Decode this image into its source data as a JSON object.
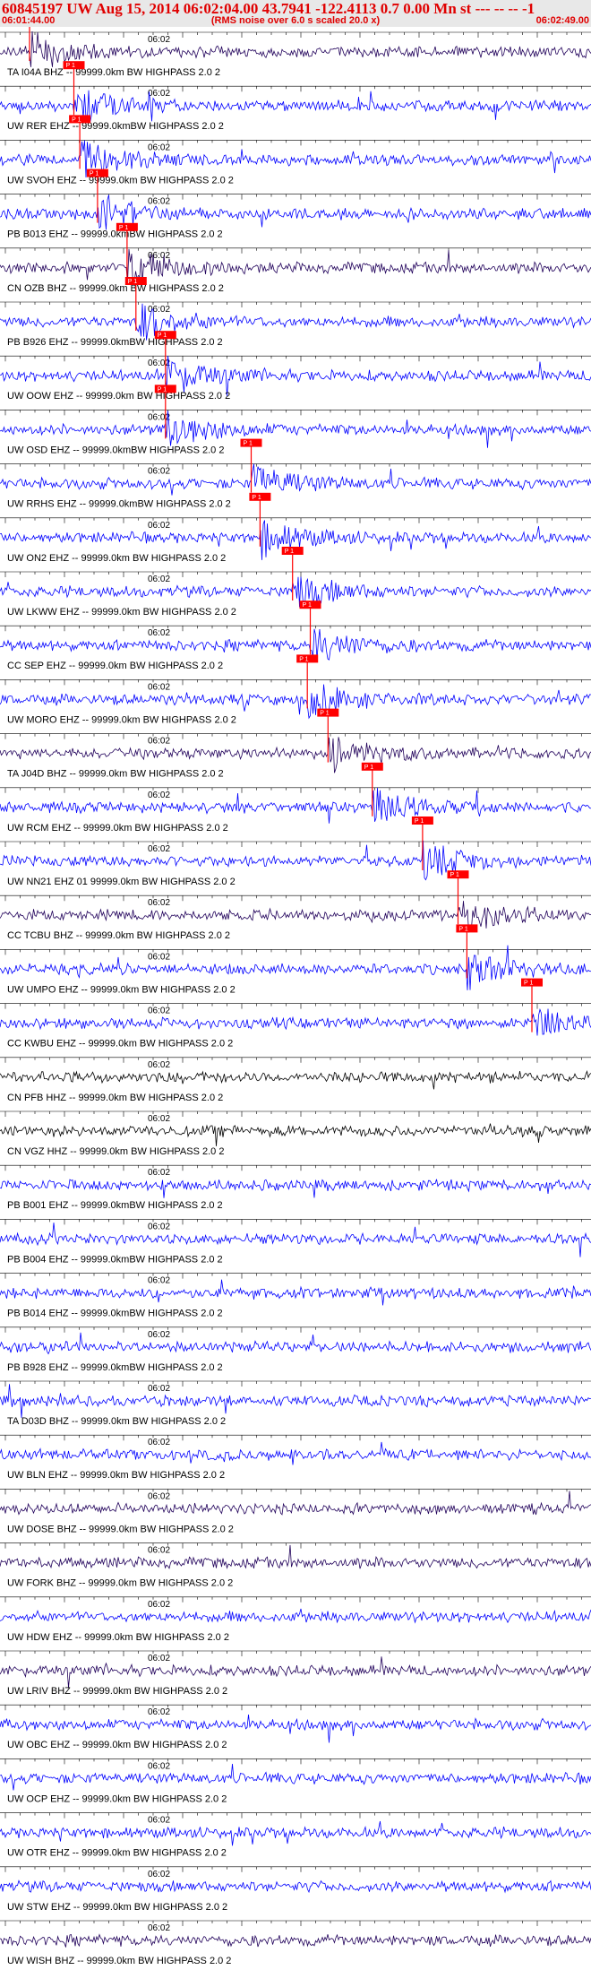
{
  "header": {
    "title": "60845197 UW Aug 15, 2014 06:02:04.00   43.7941 -122.4113  0.7 0.00 Mn st --- -- --  -1",
    "start_time": "06:01:44.00",
    "note": "(RMS noise over 6.0 s scaled 20.0 x)",
    "end_time": "06:02:49.00"
  },
  "tick_label": "06:02",
  "pick_label": "P 1",
  "colors": {
    "trace": "#0000ff",
    "trace_dark": "#20005a",
    "trace_black": "#000000",
    "pick": "#ff0000",
    "text": "#e00000"
  },
  "traces": [
    {
      "label": "TA I04A BHZ -- 99999.0km BW  HIGHPASS  2.0  2",
      "color": "dark",
      "pick": 0.05
    },
    {
      "label": "UW RER EHZ -- 99999.0kmBW  HIGHPASS  2.0  2",
      "color": "blue",
      "pick": 0.125
    },
    {
      "label": "UW SVOH EHZ -- 99999.0km BW  HIGHPASS  2.0  2",
      "color": "blue",
      "pick": 0.135
    },
    {
      "label": "PB B013 EHZ -- 99999.0kmBW  HIGHPASS  2.0  2",
      "color": "blue",
      "pick": 0.165
    },
    {
      "label": "CN OZB BHZ -- 99999.0km BW  HIGHPASS  2.0  2",
      "color": "dark",
      "pick": 0.215
    },
    {
      "label": "PB B926 EHZ -- 99999.0kmBW  HIGHPASS  2.0  2",
      "color": "blue",
      "pick": 0.23
    },
    {
      "label": "UW OOW EHZ -- 99999.0km BW  HIGHPASS  2.0  2",
      "color": "blue",
      "pick": 0.28
    },
    {
      "label": "UW OSD EHZ -- 99999.0kmBW  HIGHPASS  2.0  2",
      "color": "blue",
      "pick": 0.28
    },
    {
      "label": "UW RRHS EHZ -- 99999.0kmBW  HIGHPASS  2.0  2",
      "color": "blue",
      "pick": 0.425
    },
    {
      "label": "UW ON2 EHZ -- 99999.0km BW  HIGHPASS  2.0  2",
      "color": "blue",
      "pick": 0.44
    },
    {
      "label": "UW LKWW EHZ -- 99999.0km BW  HIGHPASS  2.0  2",
      "color": "blue",
      "pick": 0.495
    },
    {
      "label": "CC SEP EHZ -- 99999.0km BW  HIGHPASS  2.0  2",
      "color": "blue",
      "pick": 0.525
    },
    {
      "label": "UW MORO EHZ -- 99999.0km BW  HIGHPASS  2.0  2",
      "color": "blue",
      "pick": 0.52
    },
    {
      "label": "TA J04D BHZ -- 99999.0km BW  HIGHPASS  2.0  2",
      "color": "dark",
      "pick": 0.555
    },
    {
      "label": "UW RCM EHZ -- 99999.0km BW  HIGHPASS  2.0  2",
      "color": "blue",
      "pick": 0.63
    },
    {
      "label": "UW NN21 EHZ 01 99999.0km BW  HIGHPASS  2.0  2",
      "color": "blue",
      "pick": 0.715
    },
    {
      "label": "CC TCBU BHZ -- 99999.0km BW  HIGHPASS  2.0  2",
      "color": "dark",
      "pick": 0.775
    },
    {
      "label": "UW UMPO EHZ -- 99999.0km BW  HIGHPASS  2.0  2",
      "color": "blue",
      "pick": 0.79
    },
    {
      "label": "CC KWBU EHZ -- 99999.0km BW  HIGHPASS  2.0  2",
      "color": "blue",
      "pick": 0.9
    },
    {
      "label": "CN PFB HHZ -- 99999.0km BW  HIGHPASS  2.0  2",
      "color": "black",
      "pick": null
    },
    {
      "label": "CN VGZ HHZ -- 99999.0km BW  HIGHPASS  2.0  2",
      "color": "black",
      "pick": null
    },
    {
      "label": "PB B001 EHZ -- 99999.0kmBW  HIGHPASS  2.0  2",
      "color": "blue",
      "pick": null
    },
    {
      "label": "PB B004 EHZ -- 99999.0kmBW  HIGHPASS  2.0  2",
      "color": "blue",
      "pick": null
    },
    {
      "label": "PB B014 EHZ -- 99999.0kmBW  HIGHPASS  2.0  2",
      "color": "blue",
      "pick": null
    },
    {
      "label": "PB B928 EHZ -- 99999.0kmBW  HIGHPASS  2.0  2",
      "color": "blue",
      "pick": null
    },
    {
      "label": "TA D03D BHZ -- 99999.0km BW  HIGHPASS  2.0  2",
      "color": "blue",
      "pick": null
    },
    {
      "label": "UW BLN EHZ -- 99999.0km BW  HIGHPASS  2.0  2",
      "color": "blue",
      "pick": null
    },
    {
      "label": "UW DOSE BHZ -- 99999.0km BW  HIGHPASS  2.0  2",
      "color": "dark",
      "pick": null
    },
    {
      "label": "UW FORK BHZ -- 99999.0km BW  HIGHPASS  2.0  2",
      "color": "dark",
      "pick": null
    },
    {
      "label": "UW HDW EHZ -- 99999.0km BW  HIGHPASS  2.0  2",
      "color": "blue",
      "pick": null
    },
    {
      "label": "UW LRIV BHZ -- 99999.0km BW  HIGHPASS  2.0  2",
      "color": "dark",
      "pick": null
    },
    {
      "label": "UW OBC EHZ -- 99999.0km BW  HIGHPASS  2.0  2",
      "color": "blue",
      "pick": null
    },
    {
      "label": "UW OCP EHZ -- 99999.0km BW  HIGHPASS  2.0  2",
      "color": "blue",
      "pick": null
    },
    {
      "label": "UW OTR EHZ -- 99999.0km BW  HIGHPASS  2.0  2",
      "color": "blue",
      "pick": null
    },
    {
      "label": "UW STW EHZ -- 99999.0km BW  HIGHPASS  2.0  2",
      "color": "blue",
      "pick": null
    },
    {
      "label": "UW WISH BHZ -- 99999.0km BW  HIGHPASS  2.0  2",
      "color": "dark",
      "pick": null
    }
  ]
}
